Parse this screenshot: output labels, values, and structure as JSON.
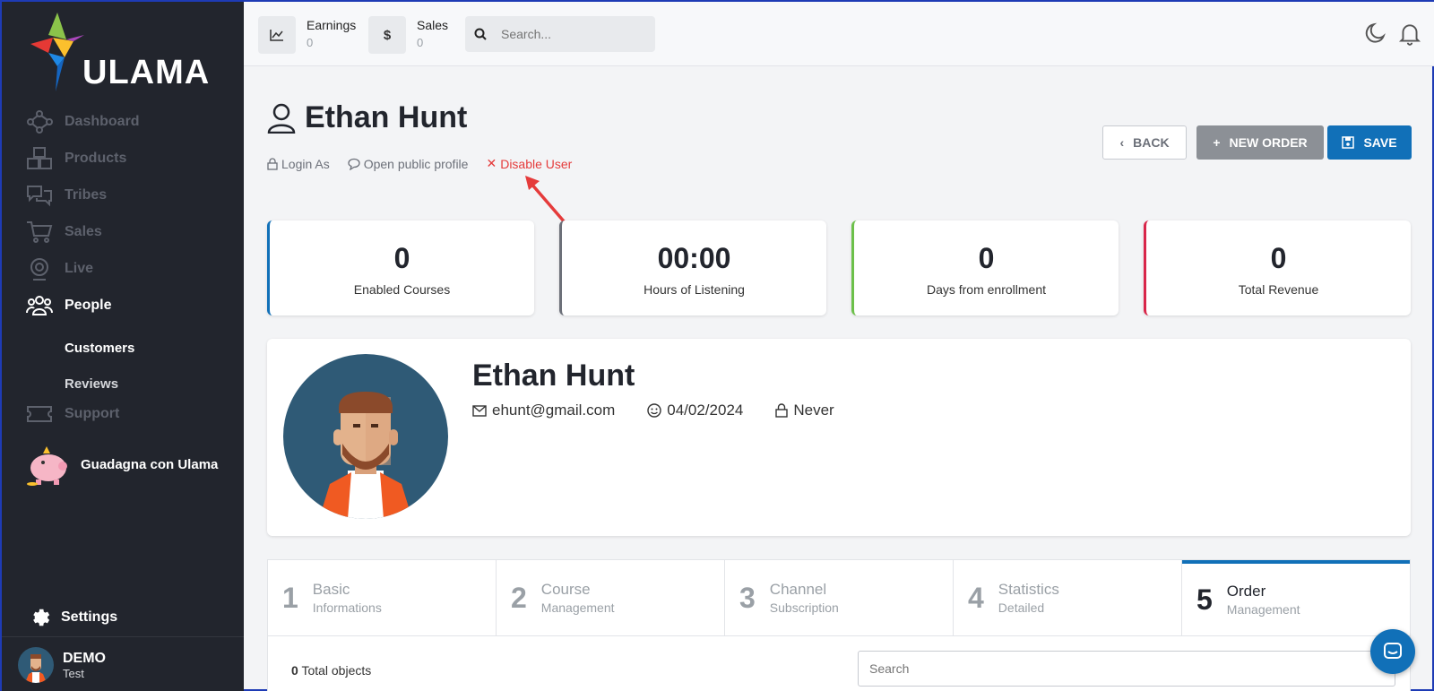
{
  "brand": {
    "name": "ULAMA"
  },
  "sidebar": {
    "items": [
      {
        "label": "Dashboard"
      },
      {
        "label": "Products"
      },
      {
        "label": "Tribes"
      },
      {
        "label": "Sales"
      },
      {
        "label": "Live"
      },
      {
        "label": "People"
      },
      {
        "label": "Support"
      }
    ],
    "sub_items": [
      {
        "label": "Customers"
      },
      {
        "label": "Reviews"
      }
    ],
    "promo": {
      "label": "Guadagna con Ulama"
    },
    "settings": {
      "label": "Settings"
    },
    "user": {
      "name": "DEMO",
      "role": "Test"
    }
  },
  "topbar": {
    "earnings": {
      "label": "Earnings",
      "value": "0"
    },
    "sales": {
      "label": "Sales",
      "value": "0"
    },
    "search_placeholder": "Search..."
  },
  "page": {
    "title": "Ethan Hunt",
    "actions": {
      "login_as": "Login As",
      "open_profile": "Open public profile",
      "disable_user": "Disable User"
    },
    "buttons": {
      "back": "BACK",
      "new_order": "NEW ORDER",
      "save": "SAVE"
    }
  },
  "stats": [
    {
      "value": "0",
      "label": "Enabled Courses",
      "color": "#1170b8"
    },
    {
      "value": "00:00",
      "label": "Hours of Listening",
      "color": "#6c7079"
    },
    {
      "value": "0",
      "label": "Days from enrollment",
      "color": "#6cc04a"
    },
    {
      "value": "0",
      "label": "Total Revenue",
      "color": "#d9264a"
    }
  ],
  "profile": {
    "name": "Ethan Hunt",
    "email": "ehunt@gmail.com",
    "date": "04/02/2024",
    "last_login": "Never"
  },
  "tabs": [
    {
      "num": "1",
      "title": "Basic",
      "sub": "Informations"
    },
    {
      "num": "2",
      "title": "Course",
      "sub": "Management"
    },
    {
      "num": "3",
      "title": "Channel",
      "sub": "Subscription"
    },
    {
      "num": "4",
      "title": "Statistics",
      "sub": "Detailed"
    },
    {
      "num": "5",
      "title": "Order",
      "sub": "Management"
    }
  ],
  "list": {
    "total_count": "0",
    "total_label": "Total objects",
    "search_placeholder": "Search"
  },
  "colors": {
    "sidebar_bg": "#22252d",
    "primary": "#1170b8",
    "danger": "#e53b3b"
  }
}
